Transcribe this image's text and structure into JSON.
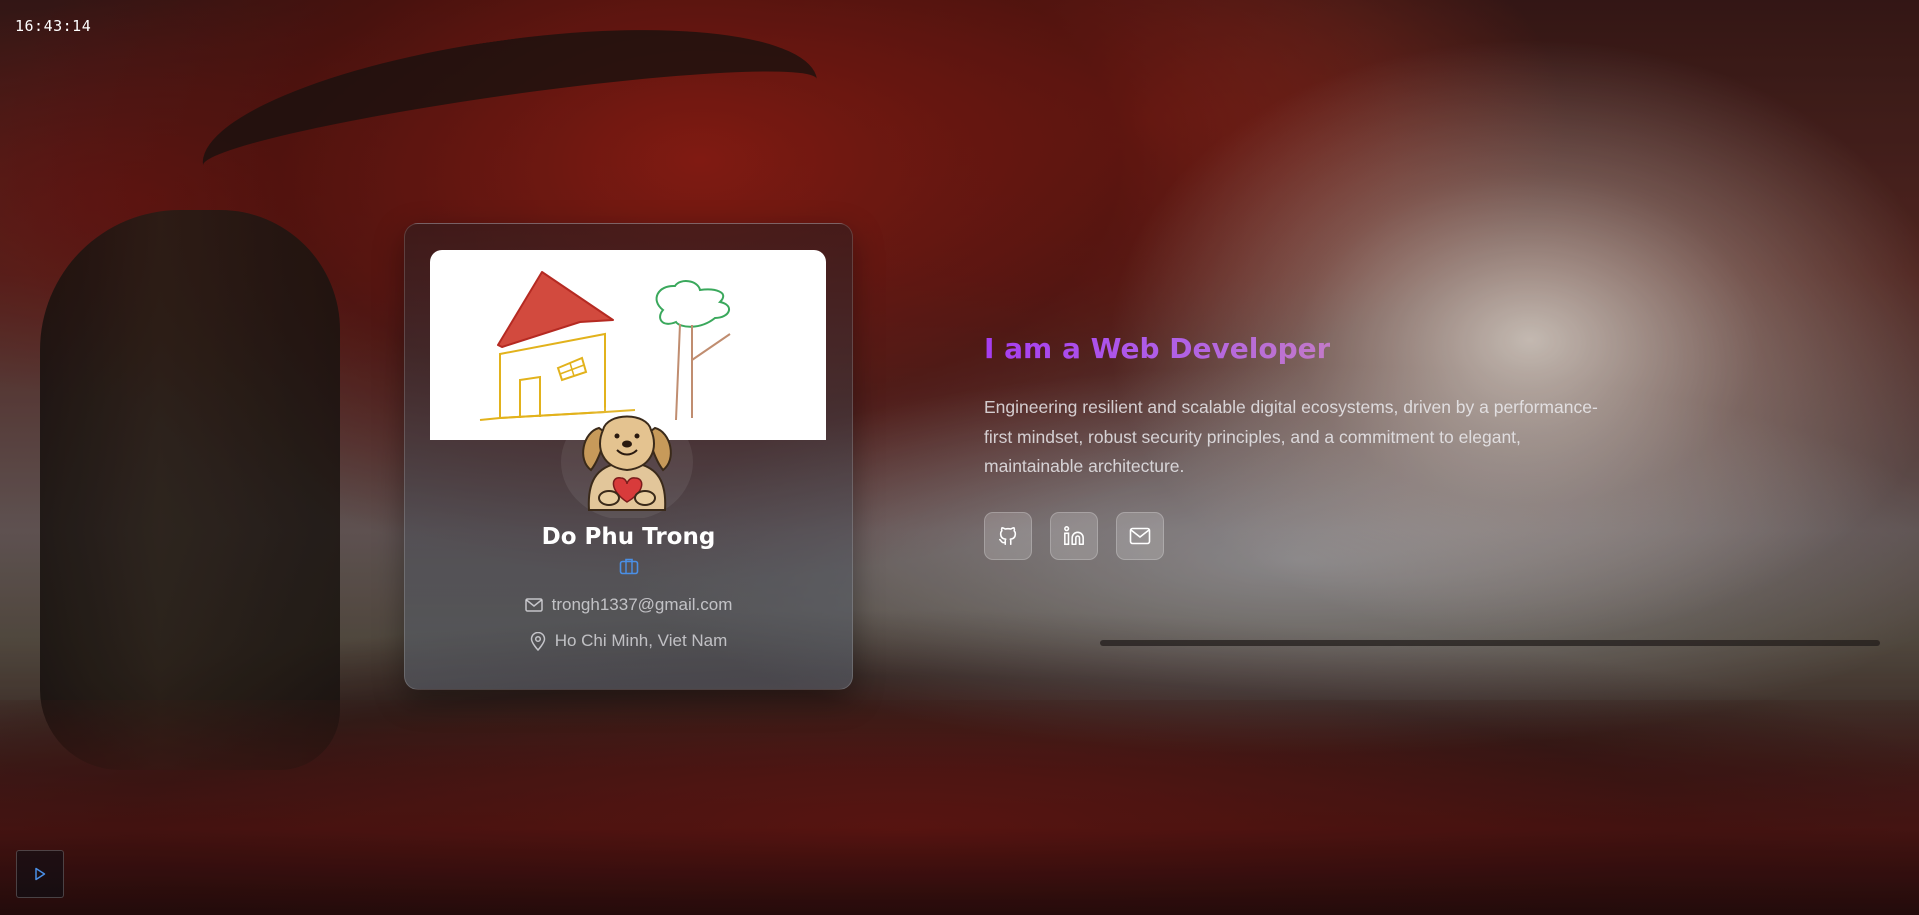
{
  "clock": {
    "time": "16:43:14"
  },
  "profile": {
    "name": "Do Phu Trong",
    "email": "trongh1337@gmail.com",
    "location": "Ho Chi Minh, Viet Nam",
    "icons": {
      "role": "briefcase-icon",
      "email": "mail-icon",
      "location": "map-pin-icon"
    }
  },
  "hero": {
    "headline": "I am a Web Developer",
    "description": "Engineering resilient and scalable digital ecosystems, driven by a performance-first mindset, robust security principles, and a commitment to elegant, maintainable architecture.",
    "gradient_colors": [
      "#a63df0",
      "#c27ac8"
    ]
  },
  "social": [
    {
      "icon": "github-icon"
    },
    {
      "icon": "linkedin-icon"
    },
    {
      "icon": "mail-icon"
    }
  ],
  "player": {
    "icon": "play-icon",
    "accent": "#4a8fe6"
  },
  "colors": {
    "card_border": "rgba(255,255,255,0.16)",
    "briefcase": "#4a8fe6"
  }
}
